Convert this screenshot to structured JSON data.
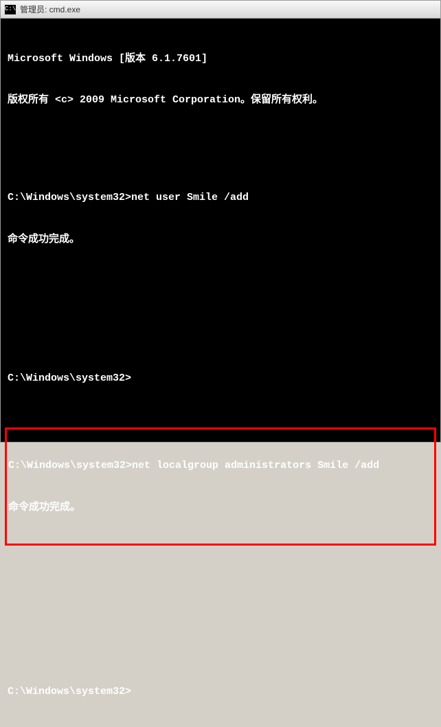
{
  "window": {
    "title": "管理员: cmd.exe",
    "icon_label": "C:\\"
  },
  "terminal": {
    "header_line1": "Microsoft Windows [版本 6.1.7601]",
    "header_line2": "版权所有 <c> 2009 Microsoft Corporation。保留所有权利。",
    "blank": " ",
    "prompts": {
      "p1": "C:\\Windows\\system32>",
      "p2": "C:\\Windows\\system32>",
      "p3": "C:\\Windows\\system32>",
      "p4": "C:\\Windows\\system32>"
    },
    "commands": {
      "cmd1": "net user Smile /add",
      "cmd2": "net localgroup administrators Smile /add"
    },
    "results": {
      "ok1": "命令成功完成。",
      "ok2": "命令成功完成。"
    }
  }
}
